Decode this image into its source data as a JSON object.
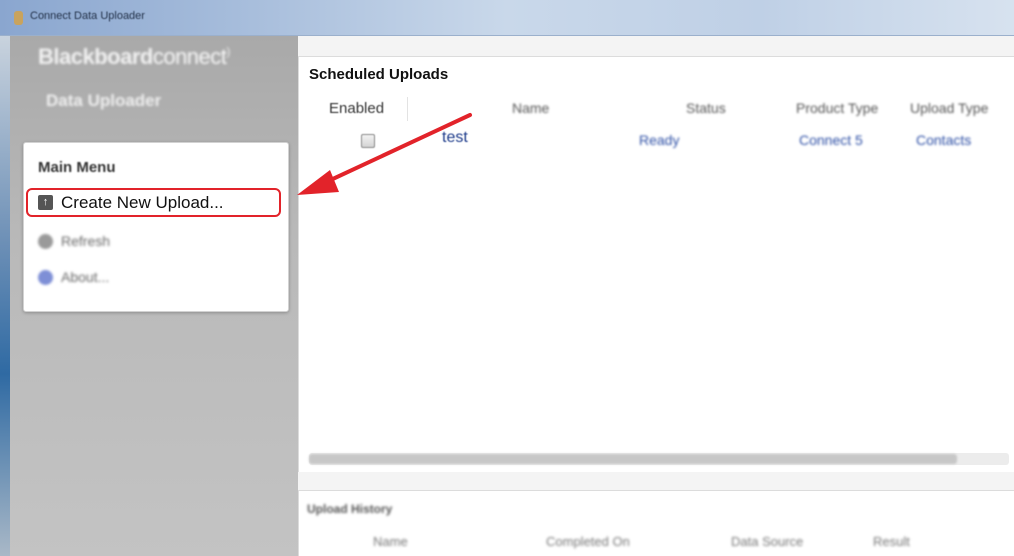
{
  "window": {
    "title": "Connect Data Uploader"
  },
  "brand": {
    "line1_bold": "Blackboard",
    "line1_light": "connect",
    "mark": ")",
    "line2": "Data Uploader"
  },
  "main_menu": {
    "title": "Main Menu",
    "items": [
      {
        "label": "Create New Upload...",
        "icon": "upload-icon"
      },
      {
        "label": "Refresh",
        "icon": "refresh-icon"
      },
      {
        "label": "About...",
        "icon": "info-icon"
      }
    ]
  },
  "scheduled_uploads": {
    "title": "Scheduled Uploads",
    "columns": [
      "Enabled",
      "Name",
      "Status",
      "Product Type",
      "Upload Type"
    ],
    "rows": [
      {
        "enabled": false,
        "name": "test",
        "status": "Ready",
        "product_type": "Connect 5",
        "upload_type": "Contacts"
      }
    ]
  },
  "upload_history": {
    "title": "Upload History",
    "columns": [
      "Name",
      "Completed On",
      "Data Source",
      "Result"
    ]
  },
  "colors": {
    "annotation": "#e2232a",
    "link_blue": "#2d4fa5"
  }
}
